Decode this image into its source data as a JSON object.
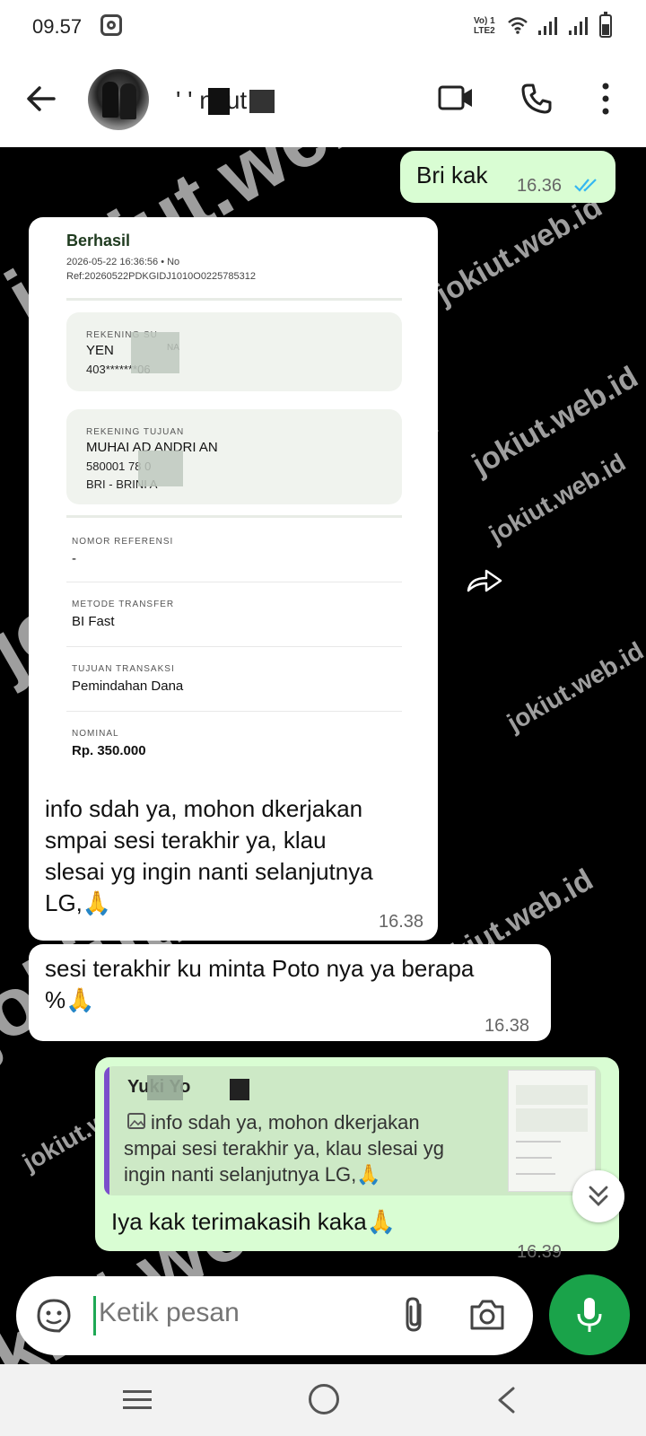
{
  "status_bar": {
    "time": "09.57",
    "network_label_top": "Vo) 1",
    "network_label_bottom": "LTE2"
  },
  "header": {
    "contact_name": "' '   ni ut"
  },
  "messages": {
    "m1": {
      "text": "Bri kak",
      "time": "16.36"
    },
    "m2": {
      "receipt": {
        "title": "Berhasil",
        "datetime": "2026-05-22 16:36:56 • No",
        "ref": "Ref:20260522PDKGIDJ1010O0225785312",
        "source_label": "REKENING SU",
        "source_name": "YEN",
        "source_name_tail": "NA",
        "source_number": "403*******06",
        "dest_label": "REKENING TUJUAN",
        "dest_name": "MUHAI  AD ANDRI      AN",
        "dest_number": "580001     78    0",
        "dest_bank": "BRI - BRINI   A",
        "ref_no_label": "NOMOR REFERENSI",
        "ref_no_value": "-",
        "method_label": "METODE TRANSFER",
        "method_value": "BI Fast",
        "purpose_label": "TUJUAN TRANSAKSI",
        "purpose_value": "Pemindahan Dana",
        "amount_label": "NOMINAL",
        "amount_value": "Rp. 350.000"
      },
      "text_line1": "info sdah ya, mohon dkerjakan",
      "text_line2": "smpai sesi terakhir ya, klau",
      "text_line3": "slesai yg ingin nanti selanjutnya",
      "text_line4": "LG,🙏",
      "time": "16.38"
    },
    "m3": {
      "text_line1": "sesi terakhir ku minta Poto nya ya berapa",
      "text_line2": "%🙏",
      "time": "16.38"
    },
    "m4": {
      "quote_author": "Yuki Yo",
      "quote_line1": "info sdah ya, mohon dkerjakan",
      "quote_line2": "smpai sesi terakhir ya, klau slesai yg",
      "quote_line3": "ingin nanti selanjutnya LG,🙏",
      "text": "Iya kak terimakasih kaka🙏",
      "time": "16.39"
    }
  },
  "watermark": {
    "big": "jokiut.web.id",
    "small": "jokiut.web.id"
  },
  "composer": {
    "placeholder": "Ketik pesan"
  },
  "colors": {
    "outgoing_bubble": "#d9fdd3",
    "incoming_bubble": "#ffffff",
    "mic_button": "#1aa34a",
    "read_ticks": "#34b7f1",
    "reply_bar": "#7b4ecb"
  }
}
